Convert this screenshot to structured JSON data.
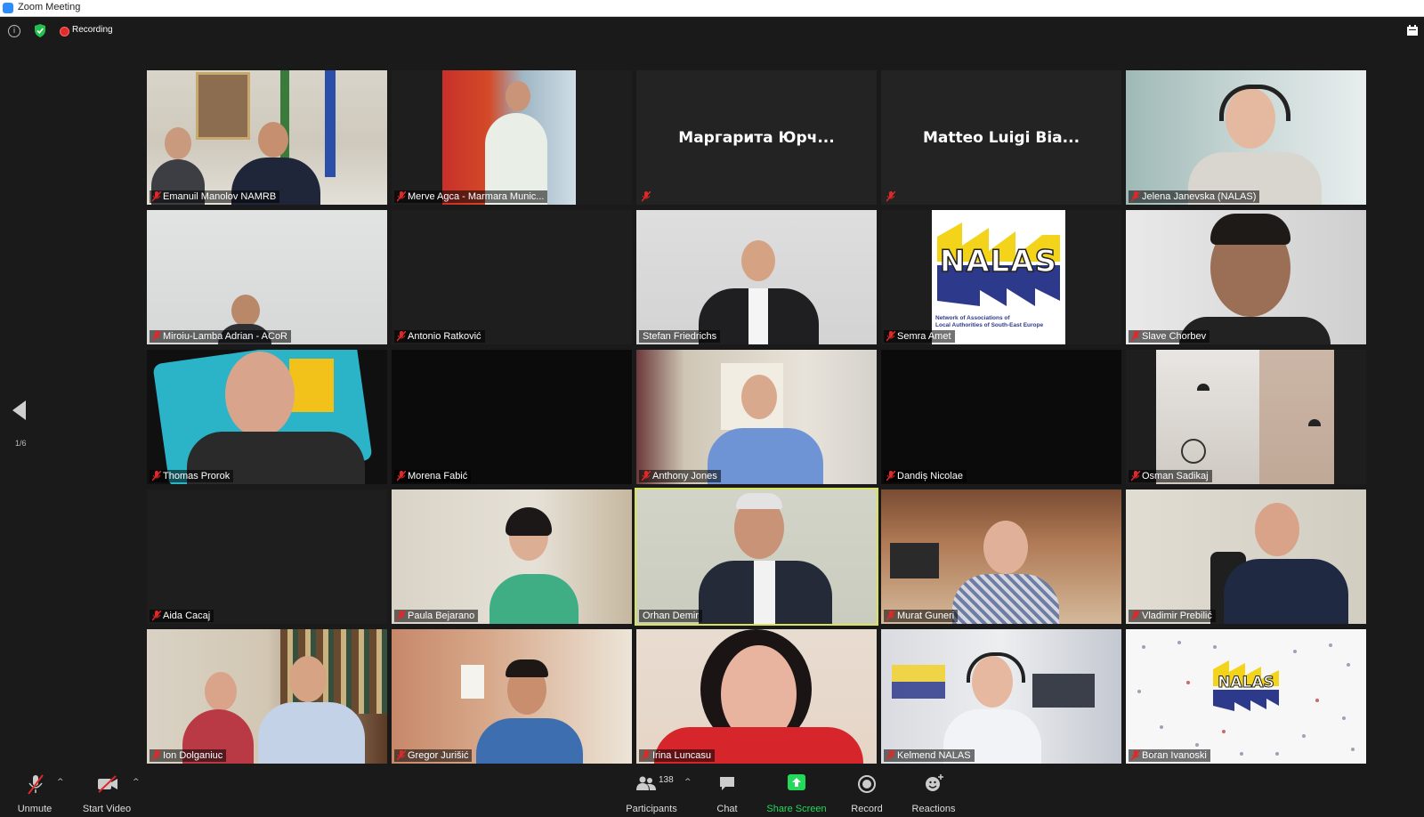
{
  "window": {
    "title": "Zoom Meeting"
  },
  "topbar": {
    "recording_label": "Recording"
  },
  "pager": {
    "page": "1/6"
  },
  "tiles": [
    {
      "name": "Emanuil Manolov NAMRB"
    },
    {
      "name": "Merve Agca - Marmara Munic..."
    },
    {
      "name": "",
      "display_name": "Маргарита Юрч..."
    },
    {
      "name": "",
      "display_name": "Matteo Luigi Bia..."
    },
    {
      "name": "Jelena Janevska (NALAS)"
    },
    {
      "name": "Miroiu-Lamba Adrian - ACoR"
    },
    {
      "name": "Antonio Ratković"
    },
    {
      "name": "Stefan Friedrichs"
    },
    {
      "name": "Semra Amet",
      "logo_text": "NALAS",
      "logo_caption_1": "Network of Associations of",
      "logo_caption_2": "Local Authorities of South-East Europe"
    },
    {
      "name": "Slave Chorbev"
    },
    {
      "name": "Thomas Prorok"
    },
    {
      "name": "Morena Fabić"
    },
    {
      "name": "Anthony Jones"
    },
    {
      "name": "Dandiș Nicolae"
    },
    {
      "name": "Osman Sadikaj"
    },
    {
      "name": "Aida Cacaj"
    },
    {
      "name": "Paula Bejarano"
    },
    {
      "name": "Orhan Demir"
    },
    {
      "name": "Murat Guneri"
    },
    {
      "name": "Vladimir Prebilić"
    },
    {
      "name": "Ion Dolganiuc"
    },
    {
      "name": "Gregor Jurišić"
    },
    {
      "name": "Irina Luncasu"
    },
    {
      "name": "Kelmend NALAS"
    },
    {
      "name": "Boran Ivanoski",
      "logo_text": "NALAS"
    }
  ],
  "toolbar": {
    "unmute": "Unmute",
    "start_video": "Start Video",
    "participants": "Participants",
    "participants_count": "138",
    "chat": "Chat",
    "share_screen": "Share Screen",
    "record": "Record",
    "reactions": "Reactions"
  },
  "colors": {
    "accent_green": "#23d959",
    "active_speaker": "#d9e35a",
    "record_red": "#e22b2b"
  }
}
